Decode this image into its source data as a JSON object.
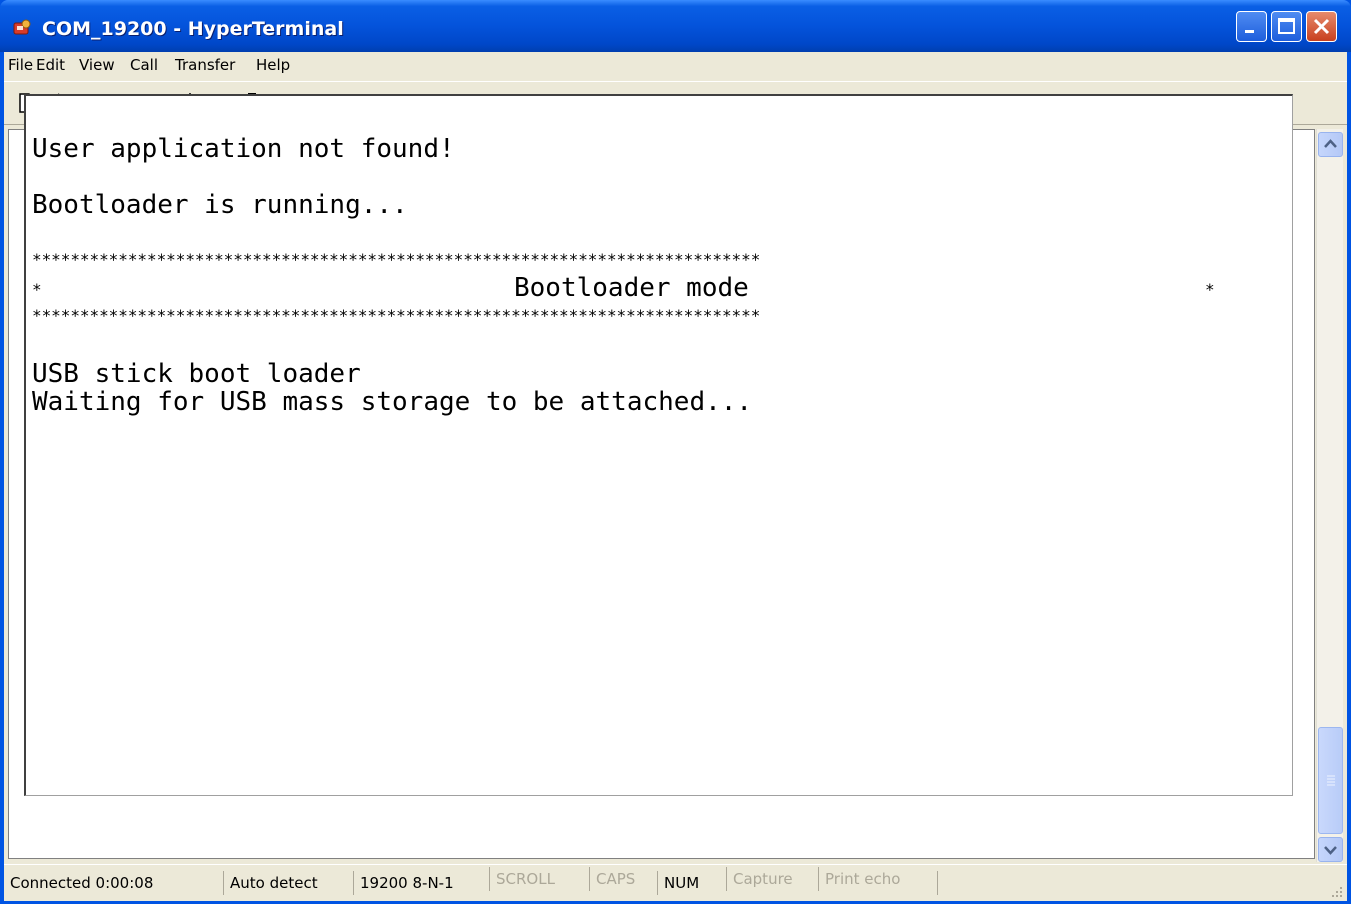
{
  "window": {
    "title": "COM_19200 - HyperTerminal"
  },
  "menubar": {
    "items": [
      {
        "label": "File",
        "name": "menu-file"
      },
      {
        "label": "Edit",
        "name": "menu-edit"
      },
      {
        "label": "View",
        "name": "menu-view"
      },
      {
        "label": "Call",
        "name": "menu-call"
      },
      {
        "label": "Transfer",
        "name": "menu-transfer"
      },
      {
        "label": "Help",
        "name": "menu-help"
      }
    ]
  },
  "toolbar": {
    "buttons": [
      "new-connection-icon",
      "open-icon",
      "disconnect-icon",
      "dial-icon",
      "send-file-icon",
      "receive-file-icon",
      "properties-icon"
    ]
  },
  "terminal": {
    "lines": [
      "User application not found!",
      "Bootloader is running...",
      "****************************************************************************",
      "*                               Bootloader mode                            *",
      "****************************************************************************",
      "USB stick boot loader",
      "Waiting for USB mass storage to be attached..."
    ]
  },
  "statusbar": {
    "connected": "Connected 0:00:08",
    "detect": "Auto detect",
    "settings": "19200 8-N-1",
    "scroll": "SCROLL",
    "caps": "CAPS",
    "num": "NUM",
    "capture": "Capture",
    "print_echo": "Print echo"
  },
  "colors": {
    "titlebar": "#0453DB",
    "chrome": "#ECE9D8",
    "terminal_bg": "#FFFFFF",
    "close_button": "#C8401F"
  }
}
